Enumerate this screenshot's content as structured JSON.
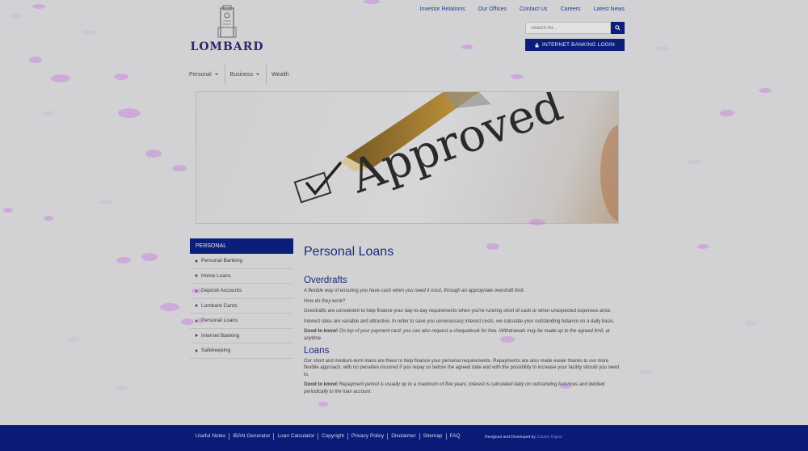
{
  "brand": {
    "name": "LOMBARD"
  },
  "top_links": [
    "Investor Relations",
    "Our Offices",
    "Contact Us",
    "Careers",
    "Latest News"
  ],
  "search": {
    "placeholder": "Search for..."
  },
  "internet_banking_button": "INTERNET BANKING LOGIN",
  "nav": {
    "personal": "Personal",
    "business": "Business",
    "wealth": "Wealth"
  },
  "banner": {
    "text": "Approved"
  },
  "sidebar": {
    "header": "PERSONAL",
    "items": [
      "Personal Banking",
      "Home Loans",
      "Deposit Accounts",
      "Lombard Cards",
      "Personal Loans",
      "Internet Banking",
      "Safekeeping"
    ]
  },
  "content": {
    "title": "Personal Loans",
    "overdrafts": {
      "heading": "Overdrafts",
      "intro": "A flexible way of ensuring you have cash when you need it most, through an appropriate overdraft limit.",
      "question": "How do they work?",
      "p1": "Overdrafts are convenient to help finance your day-to-day requirements when you're running short of cash or when unexpected expenses arise.",
      "p2": "Interest rates are variable and attractive.  In order to save you unnecessary interest costs, we calculate your outstanding balance on a daily basis.",
      "good_label": "Good to know!",
      "good_text": "On top of your payment card, you can also request a chequebook for free.  Withdrawals may be made up to the agreed limit, at anytime."
    },
    "loans": {
      "heading": "Loans",
      "p1": "Our short and medium-term loans are there to help finance your personal requirements.  Repayments are also made easier thanks to our more flexible approach, with no penalties incurred if you repay us before the agreed date and with the possibility to increase your facility should you need to.",
      "good_label": "Good to know!",
      "good_text": "Repayment period is usually up to a maximum of five years; interest is calculated daily on outstanding balances and debited periodically to the loan account."
    }
  },
  "footer": {
    "links": [
      "Useful Notes",
      "IBAN Generator",
      "Loan Calculator",
      "Copyright",
      "Privacy Policy",
      "Disclaimer",
      "Sitemap",
      "FAQ"
    ],
    "credit_prefix": "Designed and Developed by",
    "credit_name": "Zalatini Digital"
  },
  "colors": {
    "primary": "#0b1f7a",
    "heading": "#1b2a7a",
    "background": "#d2d2d4",
    "overlay_blob": "#c87ae0"
  }
}
